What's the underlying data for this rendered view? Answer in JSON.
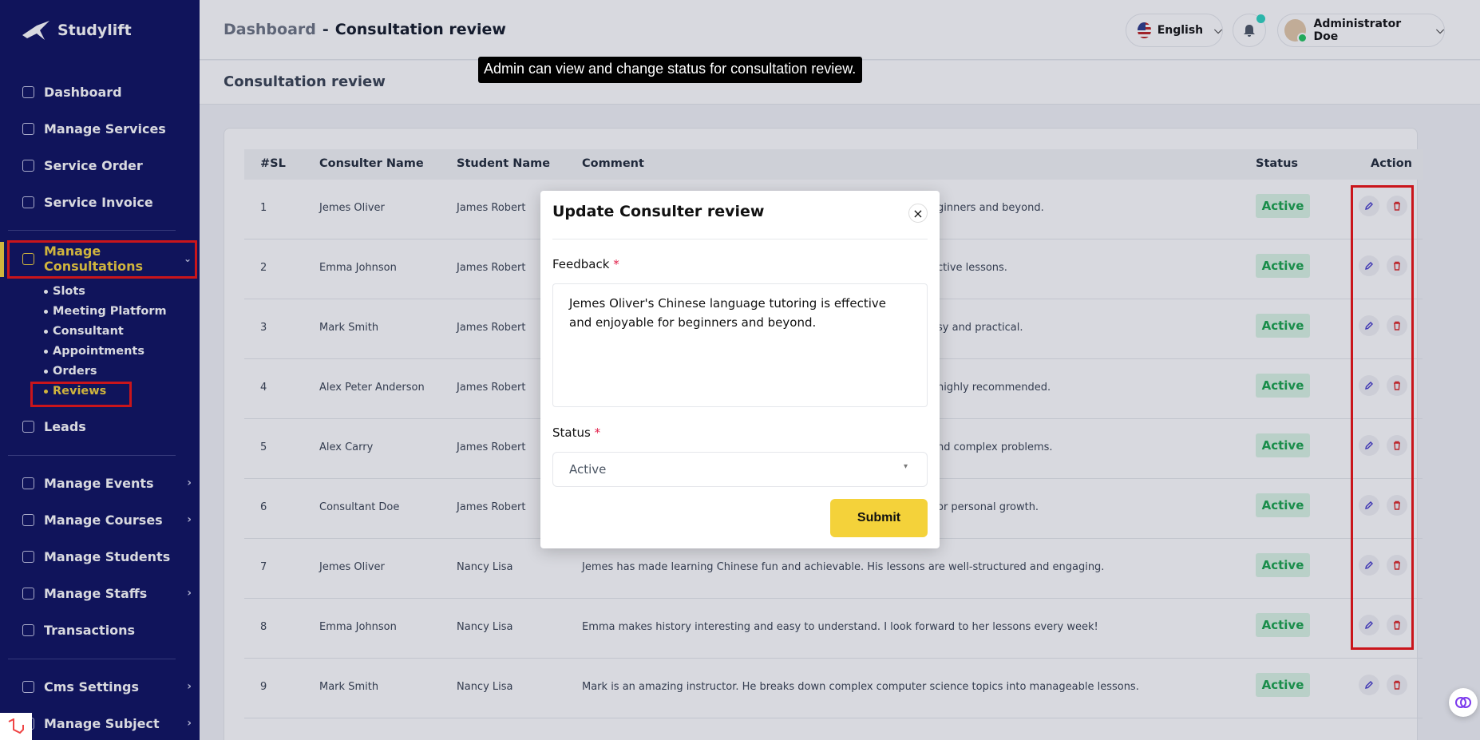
{
  "app": {
    "name": "Studylift"
  },
  "sidebar": {
    "items": [
      {
        "label": "Dashboard"
      },
      {
        "label": "Manage Services"
      },
      {
        "label": "Service Order"
      },
      {
        "label": "Service Invoice"
      },
      {
        "label": "Manage Consultations"
      },
      {
        "label": "Leads"
      },
      {
        "label": "Manage Events"
      },
      {
        "label": "Manage Courses"
      },
      {
        "label": "Manage Students"
      },
      {
        "label": "Manage Staffs"
      },
      {
        "label": "Transactions"
      },
      {
        "label": "Cms Settings"
      },
      {
        "label": "Manage Subject"
      }
    ],
    "sub_items": [
      {
        "label": "Slots"
      },
      {
        "label": "Meeting Platform"
      },
      {
        "label": "Consultant"
      },
      {
        "label": "Appointments"
      },
      {
        "label": "Orders"
      },
      {
        "label": "Reviews"
      }
    ]
  },
  "header": {
    "breadcrumb_root": "Dashboard",
    "breadcrumb_sep": "-",
    "breadcrumb_current": "Consultation review",
    "language": "English",
    "user_name": "Administrator Doe"
  },
  "page": {
    "title": "Consultation review"
  },
  "tooltip": "Admin can view and change status for consultation review.",
  "table": {
    "headers": [
      "#SL",
      "Consulter Name",
      "Student Name",
      "Comment",
      "Status",
      "Action"
    ],
    "rows": [
      {
        "sl": "1",
        "consulter": "Jemes Oliver",
        "student": "James Robert",
        "comment": "ginners and beyond.",
        "status": "Active"
      },
      {
        "sl": "2",
        "consulter": "Emma Johnson",
        "student": "James Robert",
        "comment": "ctive lessons.",
        "status": "Active"
      },
      {
        "sl": "3",
        "consulter": "Mark Smith",
        "student": "James Robert",
        "comment": "sy and practical.",
        "status": "Active"
      },
      {
        "sl": "4",
        "consulter": "Alex Peter Anderson",
        "student": "James Robert",
        "comment": "highly recommended.",
        "status": "Active"
      },
      {
        "sl": "5",
        "consulter": "Alex Carry",
        "student": "James Robert",
        "comment": "nd complex problems.",
        "status": "Active"
      },
      {
        "sl": "6",
        "consulter": "Consultant Doe",
        "student": "James Robert",
        "comment": "or personal growth.",
        "status": "Active"
      },
      {
        "sl": "7",
        "consulter": "Jemes Oliver",
        "student": "Nancy Lisa",
        "comment": "Jemes has made learning Chinese fun and achievable. His lessons are well-structured and engaging.",
        "status": "Active"
      },
      {
        "sl": "8",
        "consulter": "Emma Johnson",
        "student": "Nancy Lisa",
        "comment": "Emma makes history interesting and easy to understand. I look forward to her lessons every week!",
        "status": "Active"
      },
      {
        "sl": "9",
        "consulter": "Mark Smith",
        "student": "Nancy Lisa",
        "comment": "Mark is an amazing instructor. He breaks down complex computer science topics into manageable lessons.",
        "status": "Active"
      }
    ]
  },
  "modal": {
    "title": "Update Consulter review",
    "feedback_label": "Feedback",
    "required_mark": "*",
    "feedback_value": "Jemes Oliver's Chinese language tutoring is effective and enjoyable for beginners and beyond.",
    "status_label": "Status",
    "status_value": "Active",
    "submit_label": "Submit",
    "close_glyph": "×"
  },
  "colors": {
    "sidebar_bg": "#0c0f5e",
    "accent": "#f4d23a",
    "active_status": "#16a34a",
    "highlight_box": "#e11111"
  }
}
